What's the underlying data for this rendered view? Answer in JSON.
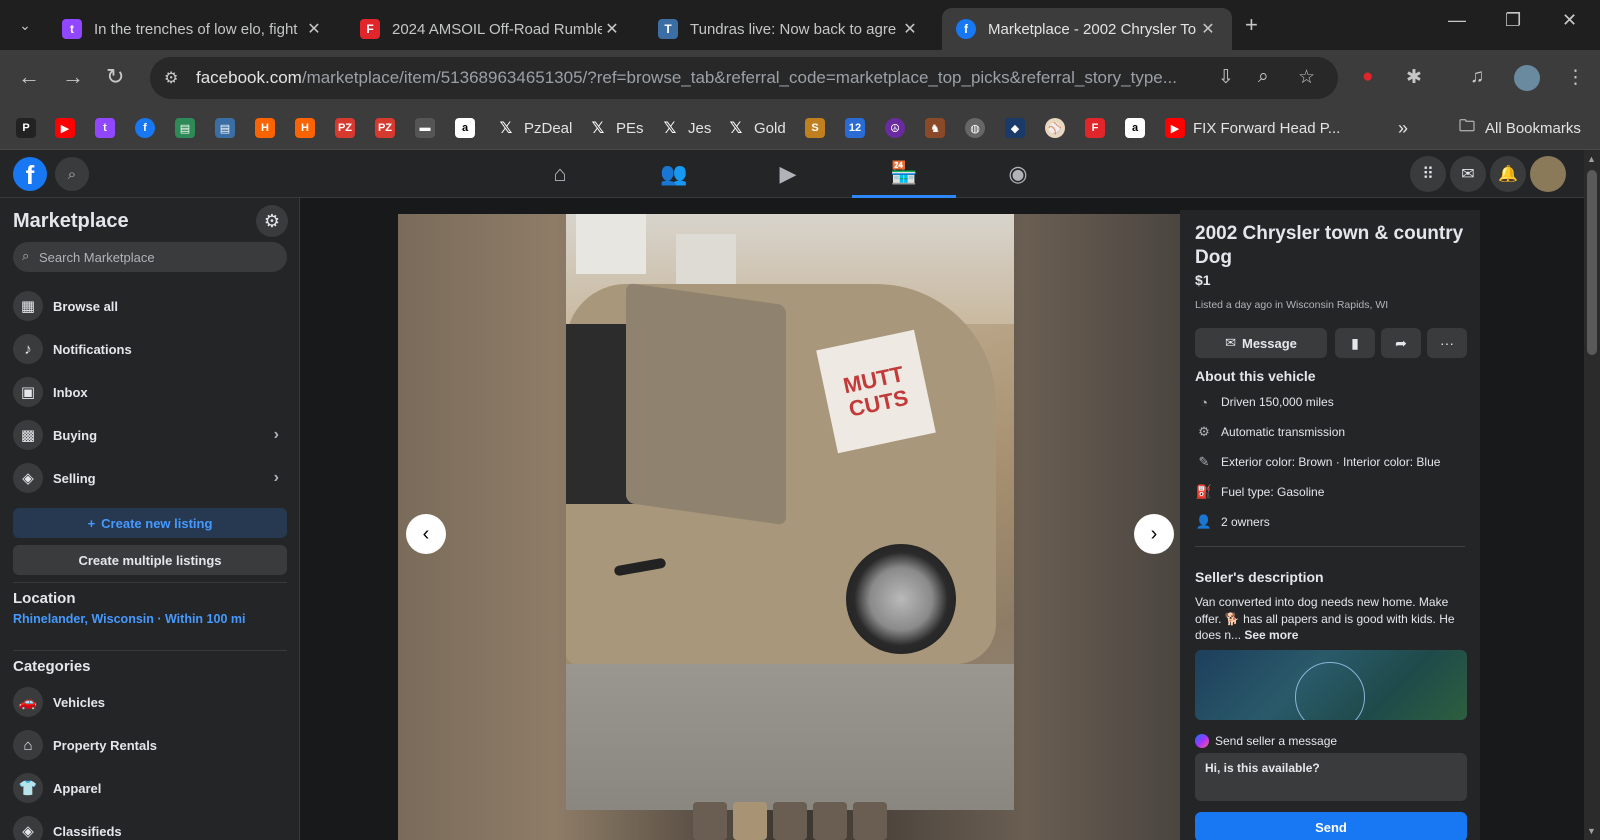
{
  "browser": {
    "tabs": [
      {
        "title": "In the trenches of low elo, fight",
        "favicon": "twitch-icon",
        "color": "#9146ff"
      },
      {
        "title": "2024 AMSOIL Off-Road Rumble",
        "favicon": "fox-sports-icon",
        "color": "#e0262b"
      },
      {
        "title": "Tundras live: Now back to agre",
        "favicon": "tundra-icon",
        "color": "#3a6ea5"
      },
      {
        "title": "Marketplace - 2002 Chrysler To",
        "favicon": "facebook-icon",
        "color": "#1877f2"
      }
    ],
    "url_domain": "facebook.com",
    "url_path": "/marketplace/item/513689634651305/?ref=browse_tab&referral_code=marketplace_top_picks&referral_story_type...",
    "bookmarks": [
      {
        "label": "PzDeal"
      },
      {
        "label": "PEs"
      },
      {
        "label": "Jes"
      },
      {
        "label": "Gold"
      },
      {
        "label": "FIX Forward Head P..."
      }
    ],
    "all_bookmarks": "All Bookmarks"
  },
  "sidebar": {
    "title": "Marketplace",
    "search_placeholder": "Search Marketplace",
    "items": [
      {
        "label": "Browse all",
        "icon": "storefront-icon"
      },
      {
        "label": "Notifications",
        "icon": "bell-icon"
      },
      {
        "label": "Inbox",
        "icon": "inbox-icon"
      },
      {
        "label": "Buying",
        "icon": "bag-icon"
      },
      {
        "label": "Selling",
        "icon": "tag-icon"
      }
    ],
    "create_listing": "Create new listing",
    "create_multiple": "Create multiple listings",
    "location_heading": "Location",
    "location_value": "Rhinelander, Wisconsin · Within 100 mi",
    "categories_heading": "Categories",
    "categories": [
      {
        "label": "Vehicles",
        "icon": "car-icon"
      },
      {
        "label": "Property Rentals",
        "icon": "house-icon"
      },
      {
        "label": "Apparel",
        "icon": "shirt-icon"
      },
      {
        "label": "Classifieds",
        "icon": "tag-icon"
      }
    ]
  },
  "photo": {
    "sign_text": "MUTT CUTS"
  },
  "listing": {
    "title": "2002 Chrysler town & country Dog",
    "price": "$1",
    "listed": "Listed a day ago in Wisconsin Rapids, WI",
    "message_button": "Message",
    "about_heading": "About this vehicle",
    "about": [
      {
        "text": "Driven 150,000 miles",
        "icon": "speedometer-icon"
      },
      {
        "text": "Automatic transmission",
        "icon": "transmission-icon"
      },
      {
        "text": "Exterior color: Brown · Interior color: Blue",
        "icon": "paint-icon"
      },
      {
        "text": "Fuel type: Gasoline",
        "icon": "fuel-icon"
      },
      {
        "text": "2 owners",
        "icon": "person-icon"
      }
    ],
    "desc_heading": "Seller's description",
    "desc_text": "Van converted into dog needs new home. Make offer. 🐕 has all papers and is good with kids. He does n...",
    "see_more": "See more",
    "send_label": "Send seller a message",
    "message_value": "Hi, is this available?",
    "send_button": "Send"
  }
}
